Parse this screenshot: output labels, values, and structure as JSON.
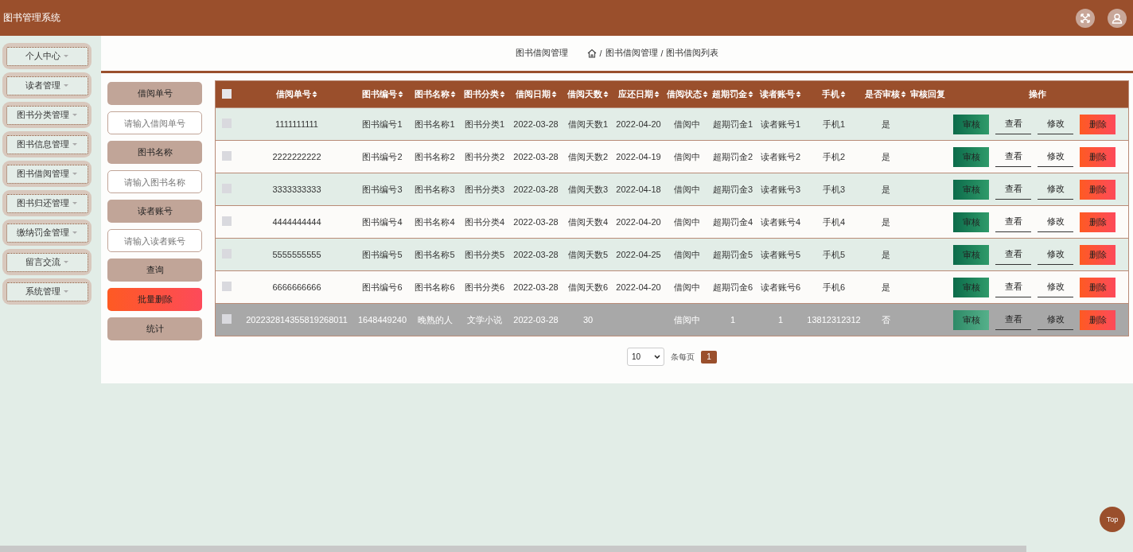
{
  "header": {
    "title": "图书管理系统"
  },
  "sidebar": {
    "items": [
      {
        "label": "个人中心"
      },
      {
        "label": "读者管理"
      },
      {
        "label": "图书分类管理"
      },
      {
        "label": "图书信息管理"
      },
      {
        "label": "图书借阅管理"
      },
      {
        "label": "图书归还管理"
      },
      {
        "label": "缴纳罚金管理"
      },
      {
        "label": "留言交流"
      },
      {
        "label": "系统管理"
      }
    ]
  },
  "page_title": "图书借阅管理",
  "breadcrumb": [
    {
      "separator": "/",
      "label": "图书借阅管理"
    },
    {
      "separator": "/",
      "label": "图书借阅列表"
    }
  ],
  "search": [
    {
      "kind": "label",
      "text": "借阅单号"
    },
    {
      "kind": "input",
      "placeholder": "请输入借阅单号"
    },
    {
      "kind": "label",
      "text": "图书名称"
    },
    {
      "kind": "input",
      "placeholder": "请输入图书名称"
    },
    {
      "kind": "label",
      "text": "读者账号"
    },
    {
      "kind": "input",
      "placeholder": "请输入读者账号"
    },
    {
      "kind": "button",
      "text": "查询"
    },
    {
      "kind": "danger",
      "text": "批量删除"
    },
    {
      "kind": "button",
      "text": "统计"
    }
  ],
  "table": {
    "all_checked": false,
    "columns": [
      {
        "label": "借阅单号",
        "sortable": true
      },
      {
        "label": "图书编号",
        "sortable": true
      },
      {
        "label": "图书名称",
        "sortable": true
      },
      {
        "label": "图书分类",
        "sortable": true
      },
      {
        "label": "借阅日期",
        "sortable": true
      },
      {
        "label": "借阅天数",
        "sortable": true
      },
      {
        "label": "应还日期",
        "sortable": true
      },
      {
        "label": "借阅状态",
        "sortable": true
      },
      {
        "label": "超期罚金",
        "sortable": true
      },
      {
        "label": "读者账号",
        "sortable": true
      },
      {
        "label": "手机",
        "sortable": true
      },
      {
        "label": "是否审核",
        "sortable": true
      },
      {
        "label": "审核回复",
        "sortable": false
      },
      {
        "label": "操作",
        "sortable": false
      }
    ],
    "rows": [
      {
        "selected": false,
        "checked": false,
        "cells": [
          "1111111111",
          "图书编号1",
          "图书名称1",
          "图书分类1",
          "2022-03-28",
          "借阅天数1",
          "2022-04-20",
          "借阅中",
          "超期罚金1",
          "读者账号1",
          "手机1",
          "是"
        ],
        "actions": [
          "审核",
          "查看",
          "修改",
          "删除"
        ]
      },
      {
        "selected": false,
        "checked": false,
        "cells": [
          "2222222222",
          "图书编号2",
          "图书名称2",
          "图书分类2",
          "2022-03-28",
          "借阅天数2",
          "2022-04-19",
          "借阅中",
          "超期罚金2",
          "读者账号2",
          "手机2",
          "是"
        ],
        "actions": [
          "审核",
          "查看",
          "修改",
          "删除"
        ]
      },
      {
        "selected": false,
        "checked": false,
        "cells": [
          "3333333333",
          "图书编号3",
          "图书名称3",
          "图书分类3",
          "2022-03-28",
          "借阅天数3",
          "2022-04-18",
          "借阅中",
          "超期罚金3",
          "读者账号3",
          "手机3",
          "是"
        ],
        "actions": [
          "审核",
          "查看",
          "修改",
          "删除"
        ]
      },
      {
        "selected": false,
        "checked": false,
        "cells": [
          "4444444444",
          "图书编号4",
          "图书名称4",
          "图书分类4",
          "2022-03-28",
          "借阅天数4",
          "2022-04-20",
          "借阅中",
          "超期罚金4",
          "读者账号4",
          "手机4",
          "是"
        ],
        "actions": [
          "审核",
          "查看",
          "修改",
          "删除"
        ]
      },
      {
        "selected": false,
        "checked": false,
        "cells": [
          "5555555555",
          "图书编号5",
          "图书名称5",
          "图书分类5",
          "2022-03-28",
          "借阅天数5",
          "2022-04-25",
          "借阅中",
          "超期罚金5",
          "读者账号5",
          "手机5",
          "是"
        ],
        "actions": [
          "审核",
          "查看",
          "修改",
          "删除"
        ]
      },
      {
        "selected": false,
        "checked": false,
        "cells": [
          "6666666666",
          "图书编号6",
          "图书名称6",
          "图书分类6",
          "2022-03-28",
          "借阅天数6",
          "2022-04-20",
          "借阅中",
          "超期罚金6",
          "读者账号6",
          "手机6",
          "是"
        ],
        "actions": [
          "审核",
          "查看",
          "修改",
          "删除"
        ]
      },
      {
        "selected": true,
        "checked": false,
        "cells": [
          "202232814355819268011",
          "1648449240",
          "晚熟的人",
          "文学小说",
          "2022-03-28",
          "30",
          "",
          "借阅中",
          "1",
          "1",
          "13812312312",
          "否"
        ],
        "actions": [
          "审核",
          "查看",
          "修改",
          "删除"
        ]
      }
    ]
  },
  "pagination": {
    "page_size": "10",
    "per_page_label": "条每页",
    "pages": [
      {
        "label": "1",
        "selected": true
      }
    ]
  },
  "top_button": "Top"
}
